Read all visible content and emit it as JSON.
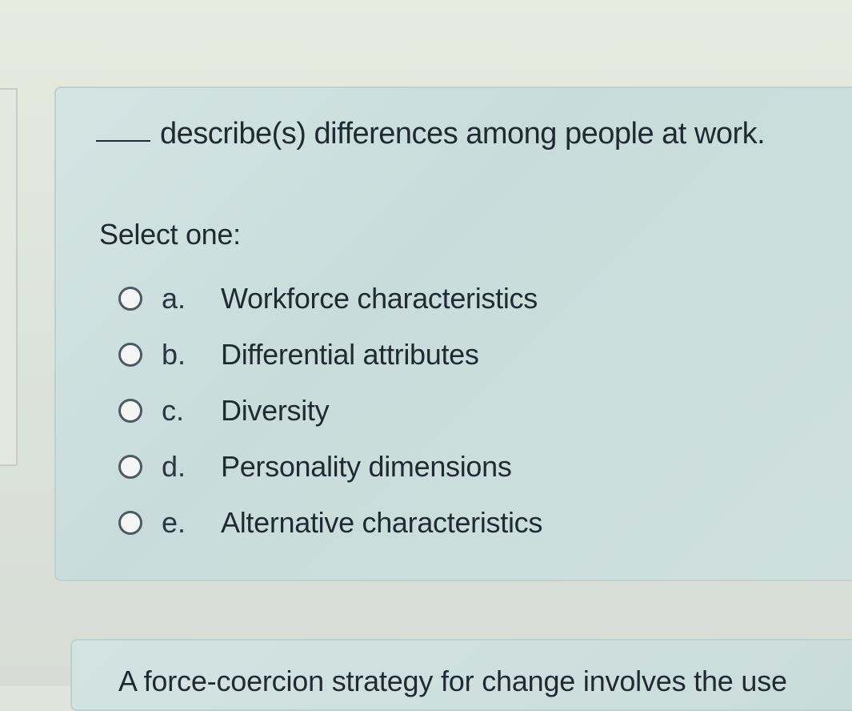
{
  "question": {
    "blank": "____",
    "text": "describe(s) differences among people at work."
  },
  "prompt": "Select one:",
  "options": [
    {
      "letter": "a.",
      "label": "Workforce characteristics"
    },
    {
      "letter": "b.",
      "label": "Differential attributes"
    },
    {
      "letter": "c.",
      "label": "Diversity"
    },
    {
      "letter": "d.",
      "label": "Personality dimensions"
    },
    {
      "letter": "e.",
      "label": "Alternative characteristics"
    }
  ],
  "next_question": {
    "text": "A force-coercion strategy for change involves the use"
  }
}
